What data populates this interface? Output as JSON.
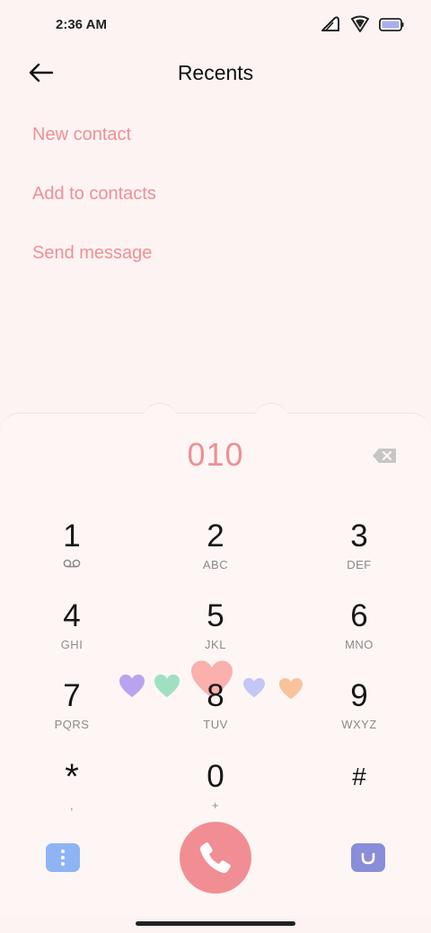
{
  "status_bar": {
    "time": "2:36 AM",
    "icons": [
      "signal-icon",
      "wifi-shield-icon",
      "battery-icon"
    ]
  },
  "header": {
    "back_icon": "arrow-left-icon",
    "title": "Recents"
  },
  "menu": {
    "items": [
      {
        "label": "New contact"
      },
      {
        "label": "Add to contacts"
      },
      {
        "label": "Send message"
      }
    ]
  },
  "dialer": {
    "number": "010",
    "backspace_icon": "backspace-icon",
    "keys": [
      {
        "digit": "1",
        "letters": "",
        "icon": "voicemail-icon"
      },
      {
        "digit": "2",
        "letters": "ABC"
      },
      {
        "digit": "3",
        "letters": "DEF"
      },
      {
        "digit": "4",
        "letters": "GHI"
      },
      {
        "digit": "5",
        "letters": "JKL"
      },
      {
        "digit": "6",
        "letters": "MNO"
      },
      {
        "digit": "7",
        "letters": "PQRS"
      },
      {
        "digit": "8",
        "letters": "TUV"
      },
      {
        "digit": "9",
        "letters": "WXYZ"
      },
      {
        "digit": "*",
        "letters": ","
      },
      {
        "digit": "0",
        "letters": "+"
      },
      {
        "digit": "#",
        "letters": ""
      }
    ]
  },
  "bottom_bar": {
    "menu_icon": "more-vertical-icon",
    "call_icon": "phone-icon",
    "smile_icon": "smile-icon"
  },
  "colors": {
    "accent": "#ef8f95",
    "background": "#fdf3f3",
    "call_button": "#f18e93",
    "menu_button": "#8fb4f4",
    "smile_button": "#8a8ed8",
    "hearts": [
      "#b9a3ee",
      "#9fe0c3",
      "#f9a8a4",
      "#c4c6f6",
      "#f8c39a"
    ]
  }
}
